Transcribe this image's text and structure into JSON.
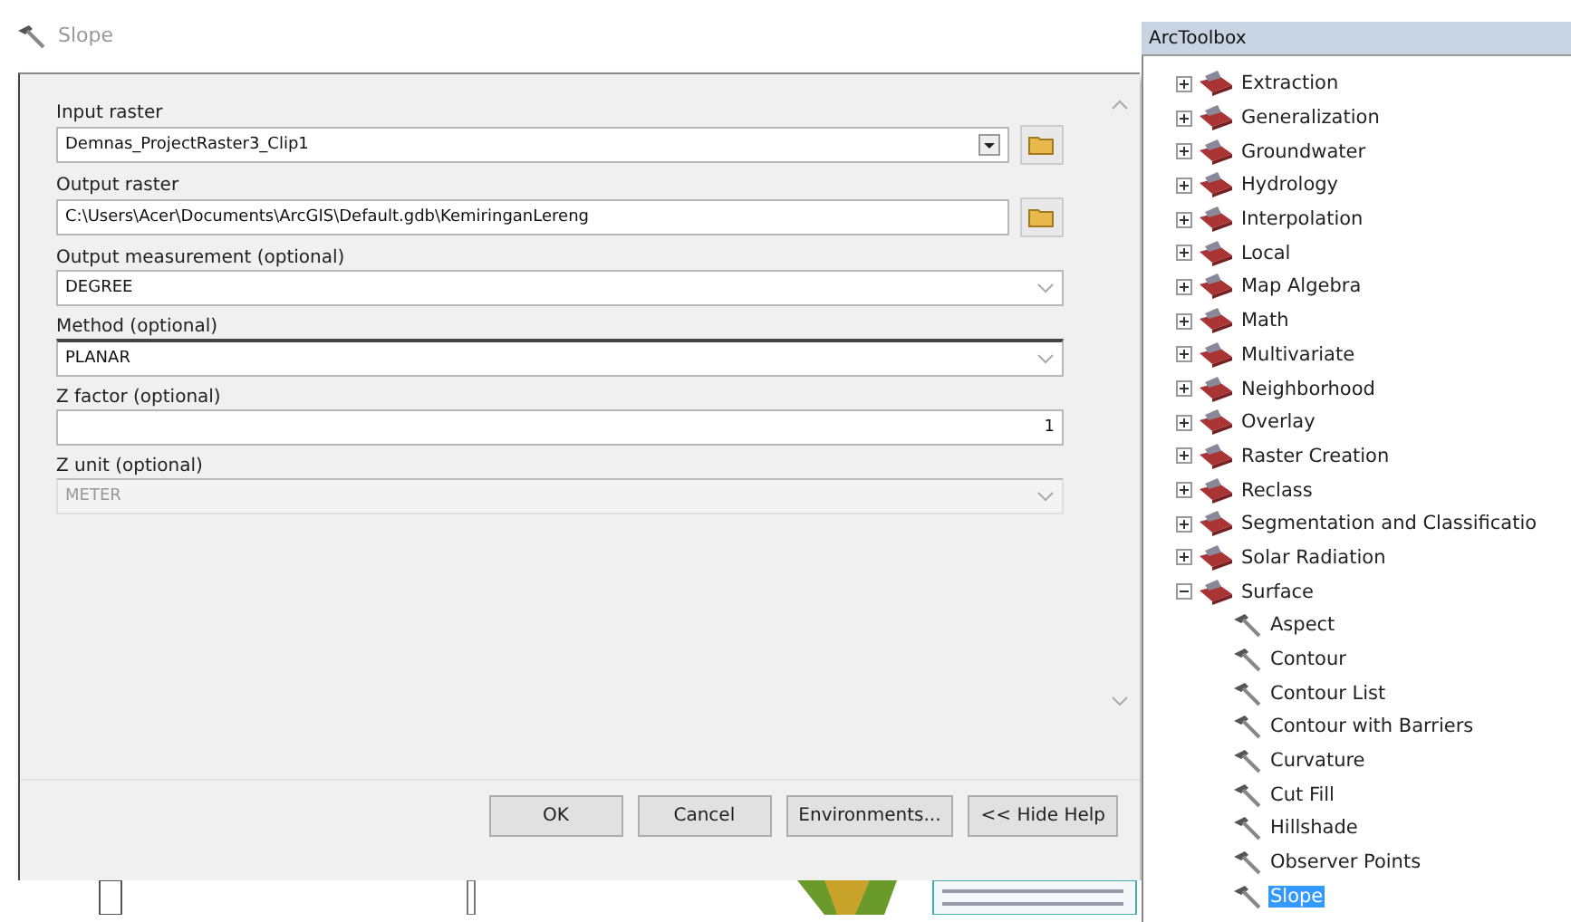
{
  "dialog": {
    "title": "Slope",
    "fields": [
      {
        "label": "Input raster",
        "kind": "dropdown",
        "value": "Demnas_ProjectRaster3_Clip1",
        "browse": true,
        "disabled": false
      },
      {
        "label": "Output raster",
        "kind": "text",
        "value": "C:\\Users\\Acer\\Documents\\ArcGIS\\Default.gdb\\KemiringanLereng",
        "browse": true,
        "disabled": false
      },
      {
        "label": "Output measurement (optional)",
        "kind": "select",
        "value": "DEGREE",
        "browse": false,
        "disabled": false
      },
      {
        "label": "Method (optional)",
        "kind": "select",
        "value": "PLANAR",
        "browse": false,
        "disabled": false
      },
      {
        "label": "Z factor (optional)",
        "kind": "number",
        "value": "1",
        "browse": false,
        "disabled": false
      },
      {
        "label": "Z unit (optional)",
        "kind": "select",
        "value": "METER",
        "browse": false,
        "disabled": true
      }
    ],
    "buttons": [
      "OK",
      "Cancel",
      "Environments...",
      "<< Hide Help"
    ]
  },
  "toolbox": {
    "title": "ArcToolbox",
    "items": [
      {
        "label": "Extraction",
        "expanded": false
      },
      {
        "label": "Generalization",
        "expanded": false
      },
      {
        "label": "Groundwater",
        "expanded": false
      },
      {
        "label": "Hydrology",
        "expanded": false
      },
      {
        "label": "Interpolation",
        "expanded": false
      },
      {
        "label": "Local",
        "expanded": false
      },
      {
        "label": "Map Algebra",
        "expanded": false
      },
      {
        "label": "Math",
        "expanded": false
      },
      {
        "label": "Multivariate",
        "expanded": false
      },
      {
        "label": "Neighborhood",
        "expanded": false
      },
      {
        "label": "Overlay",
        "expanded": false
      },
      {
        "label": "Raster Creation",
        "expanded": false
      },
      {
        "label": "Reclass",
        "expanded": false
      },
      {
        "label": "Segmentation and Classificatio",
        "expanded": false
      },
      {
        "label": "Solar Radiation",
        "expanded": false
      },
      {
        "label": "Surface",
        "expanded": true,
        "children": [
          {
            "label": "Aspect",
            "selected": false
          },
          {
            "label": "Contour",
            "selected": false
          },
          {
            "label": "Contour List",
            "selected": false
          },
          {
            "label": "Contour with Barriers",
            "selected": false
          },
          {
            "label": "Curvature",
            "selected": false
          },
          {
            "label": "Cut Fill",
            "selected": false
          },
          {
            "label": "Hillshade",
            "selected": false
          },
          {
            "label": "Observer Points",
            "selected": false
          },
          {
            "label": "Slope",
            "selected": true
          }
        ]
      }
    ]
  }
}
